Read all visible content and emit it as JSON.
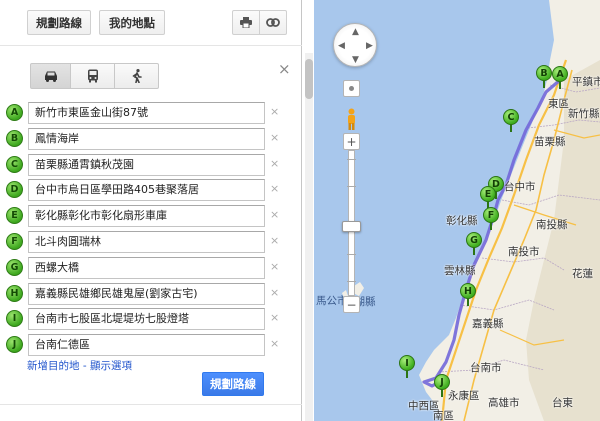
{
  "toolbar": {
    "route_label": "規劃路線",
    "mymaps_label": "我的地點",
    "print_icon": "printer-icon",
    "link_icon": "link-icon"
  },
  "modes": [
    {
      "name": "car",
      "icon": "car-icon",
      "selected": true
    },
    {
      "name": "transit",
      "icon": "bus-icon",
      "selected": false
    },
    {
      "name": "walk",
      "icon": "walking-icon",
      "selected": false
    }
  ],
  "close_glyph": "×",
  "remove_glyph": "×",
  "waypoints": [
    {
      "letter": "A",
      "value": "新竹市東區金山街87號"
    },
    {
      "letter": "B",
      "value": "鳳情海岸"
    },
    {
      "letter": "C",
      "value": "苗栗縣通霄鎮秋茂園"
    },
    {
      "letter": "D",
      "value": "台中市烏日區學田路405巷聚落居"
    },
    {
      "letter": "E",
      "value": "彰化縣彰化市彰化扇形車庫"
    },
    {
      "letter": "F",
      "value": "北斗肉圓瑞林"
    },
    {
      "letter": "G",
      "value": "西螺大橋"
    },
    {
      "letter": "H",
      "value": "嘉義縣民雄鄉民雄鬼屋(劉家古宅)"
    },
    {
      "letter": "I",
      "value": "台南市七股區北堤堤坊七股燈塔"
    },
    {
      "letter": "J",
      "value": "台南仁德區"
    }
  ],
  "links": {
    "add_destination": "新增目的地",
    "separator": " - ",
    "show_options": "顯示選項"
  },
  "submit_label": "規劃路線",
  "map": {
    "labels": {
      "pinglin": "平鎮市",
      "dongqu": "東區",
      "hsinchu": "新竹縣",
      "miaoli": "苗栗縣",
      "taichung": "台中市",
      "changhua": "彰化縣",
      "nantou_county": "南投縣",
      "nantou_city": "南投市",
      "yunlin": "雲林縣",
      "hualien": "花蓮",
      "penghu": "澎湖縣",
      "magong": "馬公市",
      "chiayi": "嘉義縣",
      "tainan": "台南市",
      "xizhong": "中西區",
      "yongkang": "永康區",
      "kaohsiung": "高雄市",
      "taitung": "台東",
      "gangshan": "南區"
    },
    "pins": [
      "A",
      "B",
      "C",
      "D",
      "E",
      "F",
      "G",
      "H",
      "I",
      "J"
    ],
    "colors": {
      "sea": "#a8c7ec",
      "land": "#f2efe6",
      "route": "#7267d9",
      "highway": "#f7c045",
      "marker": "#3fae1f"
    }
  }
}
